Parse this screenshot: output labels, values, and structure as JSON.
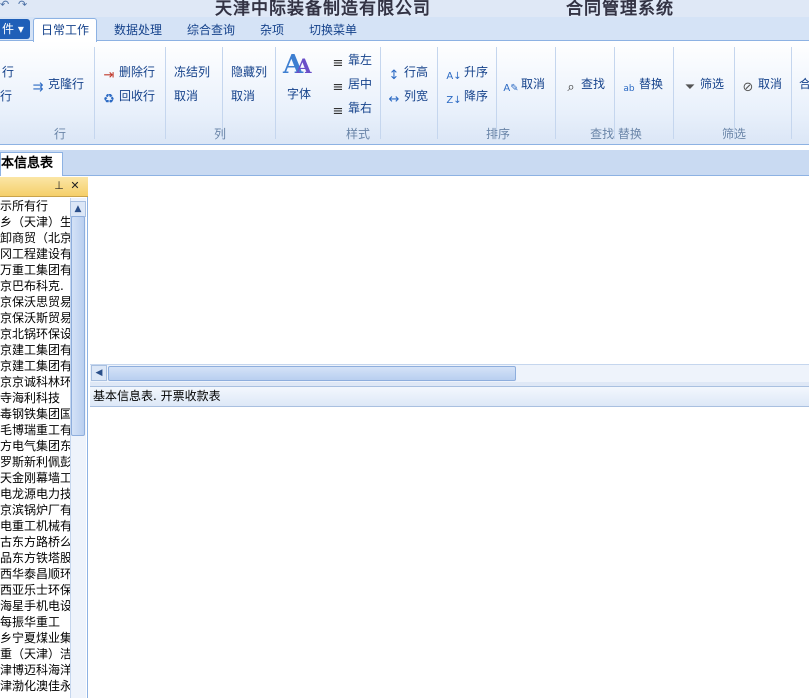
{
  "titlebar": {
    "company": "天津中际装备制造有限公司",
    "system": "合同管理系统"
  },
  "file_menu": {
    "label": "件 ▾"
  },
  "tabs": [
    {
      "label": "日常工作",
      "active": true
    },
    {
      "label": "数据处理"
    },
    {
      "label": "综合查询"
    },
    {
      "label": "杂项"
    },
    {
      "label": "切换菜单"
    }
  ],
  "ribbon": {
    "row": {
      "add_row": "行",
      "insert_row": "行",
      "clone_row": "克隆行",
      "delete_row": "删除行",
      "recycle_row": "回收行",
      "group": "行"
    },
    "column": {
      "freeze": "冻结列",
      "cancel_freeze": "取消",
      "hide": "隐藏列",
      "cancel_hide": "取消",
      "group": "列"
    },
    "style": {
      "font": "字体",
      "align_left": "靠左",
      "align_center": "居中",
      "align_right": "靠右",
      "row_height": "行高",
      "col_width": "列宽",
      "group": "样式"
    },
    "sort": {
      "asc": "升序",
      "desc": "降序",
      "cancel": "取消",
      "group": "排序"
    },
    "find": {
      "find": "查找",
      "replace": "替换",
      "group": "查找 替换"
    },
    "filter": {
      "filter": "筛选",
      "cancel": "取消",
      "group": "筛选"
    },
    "more": {
      "label": "合"
    }
  },
  "doc_tab": {
    "label": "基本信息表"
  },
  "left_panel": {
    "items": [
      "示所有行",
      "乡（天津）生",
      "卸商贸（北京",
      "冈工程建设有",
      "万重工集团有",
      "京巴布科克.",
      "京保沃思贸易",
      "京保沃斯贸易",
      "京北锅环保设",
      "京建工集团有",
      "京建工集团有",
      "京京诚科林环",
      "寺海利科技",
      "毒钢铁集团国",
      "毛博瑞重工有",
      "方电气集团东",
      "罗斯新利佩彭",
      "天金刚幕墙工",
      "电龙源电力技",
      "京滨锅炉厂有",
      "电重工机械有",
      "古东方路桥么",
      "品东方铁塔股",
      "西华泰昌顺环",
      "西亚乐士环保",
      "海星手机电设",
      "每振华重工",
      "乡宁夏煤业集",
      "重（天津）洁",
      "津博迈科海洋",
      "津渤化澳佳永"
    ]
  },
  "grid_caption": "基本信息表. 开票收款表"
}
